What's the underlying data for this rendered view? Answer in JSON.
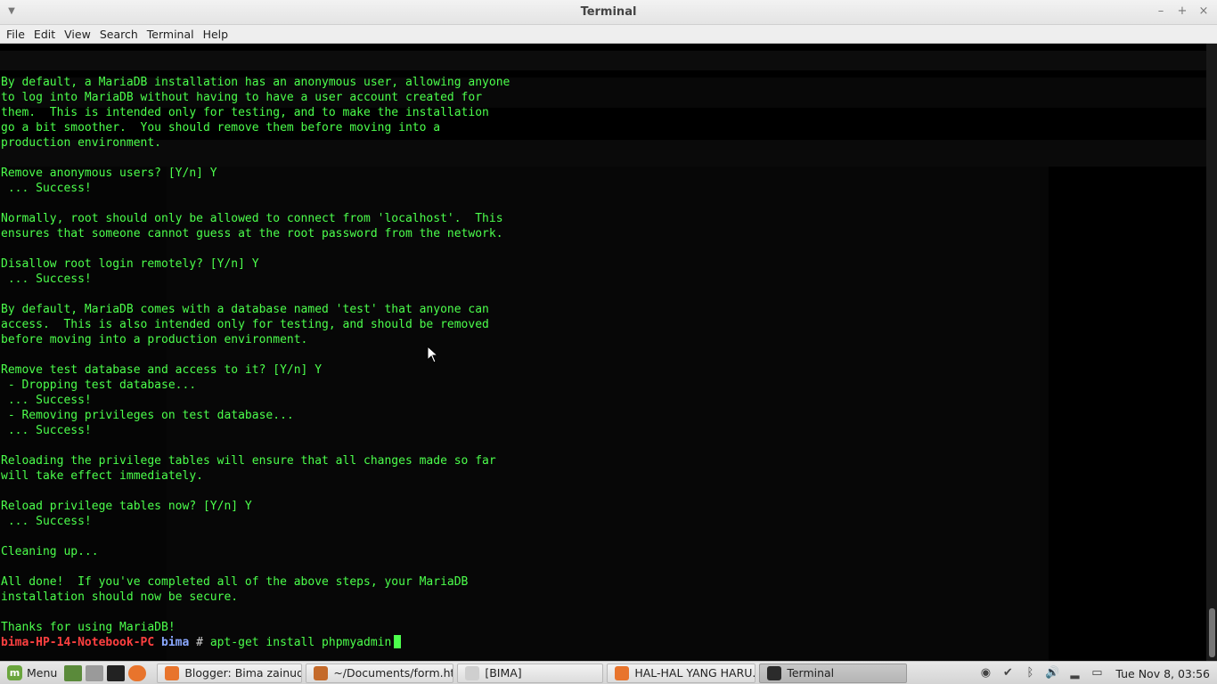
{
  "window": {
    "title": "Terminal",
    "controls": {
      "minimize": "–",
      "maximize": "+",
      "close": "×"
    }
  },
  "menubar": [
    "File",
    "Edit",
    "View",
    "Search",
    "Terminal",
    "Help"
  ],
  "terminal": {
    "lines": [
      "By default, a MariaDB installation has an anonymous user, allowing anyone",
      "to log into MariaDB without having to have a user account created for",
      "them.  This is intended only for testing, and to make the installation",
      "go a bit smoother.  You should remove them before moving into a",
      "production environment.",
      "",
      "Remove anonymous users? [Y/n] Y",
      " ... Success!",
      "",
      "Normally, root should only be allowed to connect from 'localhost'.  This",
      "ensures that someone cannot guess at the root password from the network.",
      "",
      "Disallow root login remotely? [Y/n] Y",
      " ... Success!",
      "",
      "By default, MariaDB comes with a database named 'test' that anyone can",
      "access.  This is also intended only for testing, and should be removed",
      "before moving into a production environment.",
      "",
      "Remove test database and access to it? [Y/n] Y",
      " - Dropping test database...",
      " ... Success!",
      " - Removing privileges on test database...",
      " ... Success!",
      "",
      "Reloading the privilege tables will ensure that all changes made so far",
      "will take effect immediately.",
      "",
      "Reload privilege tables now? [Y/n] Y",
      " ... Success!",
      "",
      "Cleaning up...",
      "",
      "All done!  If you've completed all of the above steps, your MariaDB",
      "installation should now be secure.",
      "",
      "Thanks for using MariaDB!"
    ],
    "prompt": {
      "user_host": "bima-HP-14-Notebook-PC",
      "dir": "bima",
      "symbol": "#",
      "command": "apt-get install phpmyadmin"
    }
  },
  "taskbar": {
    "menu_label": "Menu",
    "tasks": [
      {
        "label": "Blogger: Bima zainudi...",
        "icon_color": "#e8742c",
        "active": false
      },
      {
        "label": "~/Documents/form.ht...",
        "icon_color": "#c46a2a",
        "active": false
      },
      {
        "label": "[BIMA]",
        "icon_color": "#cfcfcf",
        "active": false
      },
      {
        "label": "HAL-HAL YANG HARU...",
        "icon_color": "#e8742c",
        "active": false
      },
      {
        "label": "Terminal",
        "icon_color": "#2b2b2b",
        "active": true
      }
    ],
    "clock": "Tue Nov  8, 03:56"
  },
  "colors": {
    "terminal_text": "#4cff4c",
    "prompt_user": "#ff4040",
    "prompt_dir": "#8aa8ff"
  }
}
